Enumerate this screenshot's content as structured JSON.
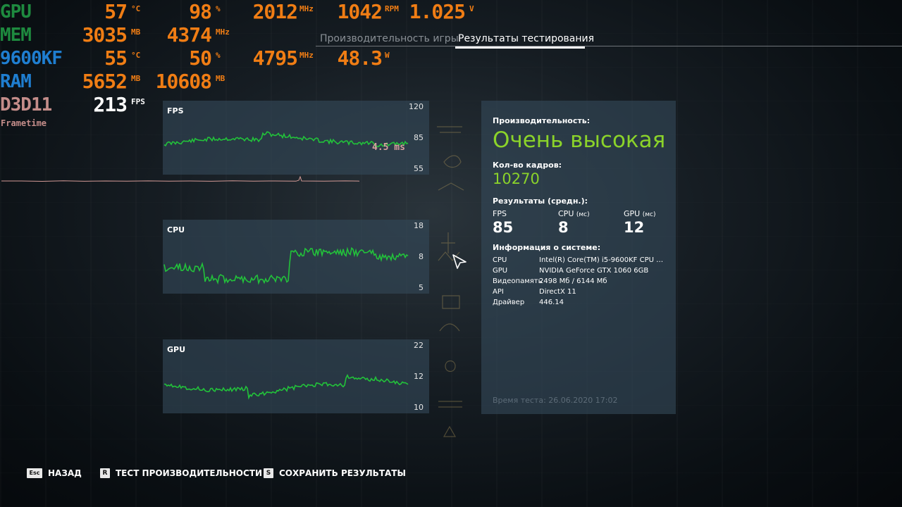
{
  "osd": {
    "gpu": {
      "label": "GPU",
      "temp": "57",
      "temp_unit": "°C",
      "load": "98",
      "load_unit": "%",
      "clock": "2012",
      "clock_unit": "MHz",
      "fan": "1042",
      "fan_unit": "RPM",
      "voltage": "1.025",
      "voltage_unit": "V"
    },
    "mem": {
      "label": "MEM",
      "used": "3035",
      "used_unit": "MB",
      "clock": "4374",
      "clock_unit": "MHz"
    },
    "cpu": {
      "label": "9600KF",
      "temp": "55",
      "temp_unit": "°C",
      "load": "50",
      "load_unit": "%",
      "clock": "4795",
      "clock_unit": "MHz",
      "power": "48.3",
      "power_unit": "W"
    },
    "ram": {
      "label": "RAM",
      "used": "5652",
      "used_unit": "MB",
      "total": "10608",
      "total_unit": "MB"
    },
    "api": {
      "label": "D3D11",
      "fps": "213",
      "fps_unit": "FPS"
    },
    "frametime_label": "Frametime",
    "frametime_value": "4.5 ms"
  },
  "tabs": [
    {
      "label": "Производительность игры",
      "active": false
    },
    {
      "label": "Результаты тестирования",
      "active": true
    }
  ],
  "graphs": {
    "fps": {
      "title": "FPS",
      "ticks": [
        "120",
        "85",
        "55"
      ]
    },
    "cpu": {
      "title": "CPU",
      "ticks": [
        "18",
        "8",
        "5"
      ]
    },
    "gpu": {
      "title": "GPU",
      "ticks": [
        "22",
        "12",
        "10"
      ]
    }
  },
  "results": {
    "performance_label": "Производительность:",
    "performance_value": "Очень высокая",
    "frames_label": "Кол-во кадров:",
    "frames_value": "10270",
    "avg_label": "Результаты (средн.):",
    "avg": [
      {
        "name": "FPS",
        "unit": "",
        "value": "85"
      },
      {
        "name": "CPU",
        "unit": "(мс)",
        "value": "8"
      },
      {
        "name": "GPU",
        "unit": "(мс)",
        "value": "12"
      }
    ],
    "sysinfo_label": "Информация о системе:",
    "sysinfo": [
      {
        "key": "CPU",
        "value": "Intel(R) Core(TM) i5-9600KF CPU @ 3..."
      },
      {
        "key": "GPU",
        "value": "NVIDIA GeForce GTX 1060 6GB"
      },
      {
        "key": "Видеопамять",
        "value": "2498 Мб / 6144 Мб"
      },
      {
        "key": "API",
        "value": "DirectX 11"
      },
      {
        "key": "Драйвер",
        "value": "446.14"
      }
    ],
    "test_time": "Время теста: 26.06.2020 17:02"
  },
  "bottom": [
    {
      "key": "Esc",
      "label": "НАЗАД"
    },
    {
      "key": "R",
      "label": "ТЕСТ ПРОИЗВОДИТЕЛЬНОСТИ"
    },
    {
      "key": "S",
      "label": "СОХРАНИТЬ РЕЗУЛЬТАТЫ"
    }
  ],
  "colors": {
    "accent_green": "#8bd32a",
    "osd_orange": "#f07d14",
    "osd_gpu_green": "#1e8a3f",
    "osd_cpu_blue": "#1f7ed0",
    "osd_api_pink": "#c48d8a",
    "graph_line": "#22c23a"
  }
}
